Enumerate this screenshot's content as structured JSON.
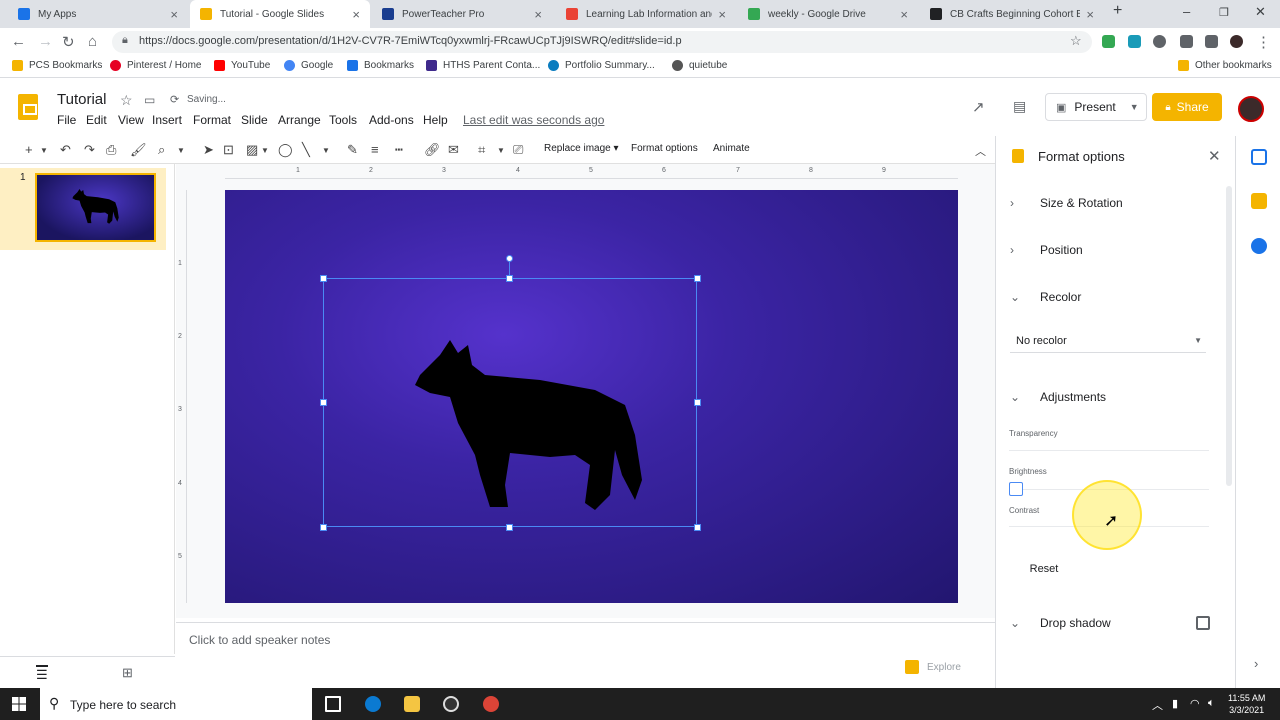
{
  "browser": {
    "tabs": [
      {
        "title": "My Apps",
        "color": "#1a73e8"
      },
      {
        "title": "Tutorial - Google Slides",
        "color": "#f4b400"
      },
      {
        "title": "PowerTeacher Pro",
        "color": "#1a3d8f"
      },
      {
        "title": "Learning Lab Information and",
        "color": "#ea4335"
      },
      {
        "title": "weekly - Google Drive",
        "color": "#34a853"
      },
      {
        "title": "CB Crafts Beginning Cohort B",
        "color": "#202124"
      }
    ],
    "url": "https://docs.google.com/presentation/d/1H2V-CV7R-7EmiWTcq0yxwmlrj-FRcawUCpTJj9ISWRQ/edit#slide=id.p",
    "bookmarks": [
      "PCS Bookmarks",
      "Pinterest / Home",
      "YouTube",
      "Google",
      "Bookmarks",
      "HTHS Parent Conta...",
      "Portfolio Summary...",
      "quietube"
    ],
    "other_bookmarks": "Other bookmarks"
  },
  "header": {
    "title": "Tutorial",
    "status": "Saving...",
    "menus": [
      "File",
      "Edit",
      "View",
      "Insert",
      "Format",
      "Slide",
      "Arrange",
      "Tools",
      "Add-ons",
      "Help"
    ],
    "last_edit": "Last edit was seconds ago",
    "present_label": "Present",
    "share_label": "Share"
  },
  "toolbar": {
    "replace_image": "Replace image",
    "format_options": "Format options",
    "animate": "Animate"
  },
  "filmstrip": {
    "slide_number": "1"
  },
  "rulers": {
    "horizontal": [
      "1",
      "2",
      "3",
      "4",
      "5",
      "6",
      "7",
      "8",
      "9"
    ],
    "vertical": [
      "1",
      "2",
      "3",
      "4",
      "5"
    ]
  },
  "notes": {
    "placeholder": "Click to add speaker notes"
  },
  "explore_label": "Explore",
  "panel": {
    "title": "Format options",
    "sections": {
      "size_rotation": "Size & Rotation",
      "position": "Position",
      "recolor": "Recolor",
      "adjustments": "Adjustments",
      "drop_shadow": "Drop shadow"
    },
    "recolor_value": "No recolor",
    "sliders": {
      "transparency": "Transparency",
      "brightness": "Brightness",
      "contrast": "Contrast"
    },
    "reset_label": "Reset"
  },
  "taskbar": {
    "search_placeholder": "Type here to search",
    "time": "11:55 AM",
    "date": "3/3/2021"
  }
}
